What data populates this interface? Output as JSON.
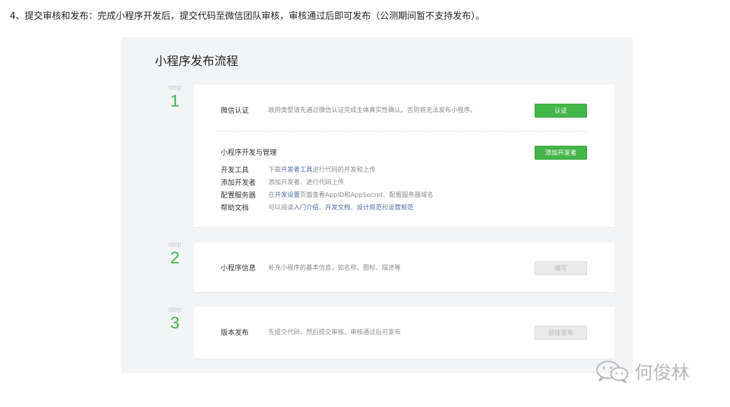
{
  "intro": "4、提交审核和发布：完成小程序开发后，提交代码至微信团队审核，审核通过后即可发布（公测期间暂不支持发布）。",
  "panel": {
    "title": "小程序发布流程",
    "steps": [
      {
        "label": "step",
        "number": "1",
        "rows": [
          {
            "label": "微信认证",
            "text": "政府类型请先通过微信认证完成主体真实性确认。否则将无法发布小程序。"
          }
        ],
        "button": "认证",
        "sub_title": "小程序开发与管理",
        "sub_button": "添加开发者",
        "dev_rows": [
          {
            "label": "开发工具",
            "parts": [
              "下载",
              "开发者工具",
              "进行代码的开发和上传"
            ]
          },
          {
            "label": "添加开发者",
            "text": "添加开发者、进行代码上传"
          },
          {
            "label": "配置服务器",
            "parts": [
              "在",
              "开发设置",
              "页面查看AppID和AppSecret、配置服务器域名"
            ]
          },
          {
            "label": "帮助文档",
            "parts": [
              "可以阅读",
              "入门介绍",
              "、",
              "开发文档",
              "、",
              "设计规范",
              "和",
              "运营规范"
            ]
          }
        ]
      },
      {
        "label": "step",
        "number": "2",
        "row_label": "小程序信息",
        "text": "补充小程序的基本信息，如名称、图标、描述等",
        "button": "填写"
      },
      {
        "label": "step",
        "number": "3",
        "row_label": "版本发布",
        "text": "先提交代码，然后提交审核，审核通过后可发布",
        "button": "前往发布"
      }
    ]
  },
  "watermark": {
    "text": "何俊林",
    "icon": "wechat-logo"
  },
  "colors": {
    "accent": "#44b549",
    "link": "#4a6aa5",
    "panel_bg": "#f3f4f6"
  }
}
